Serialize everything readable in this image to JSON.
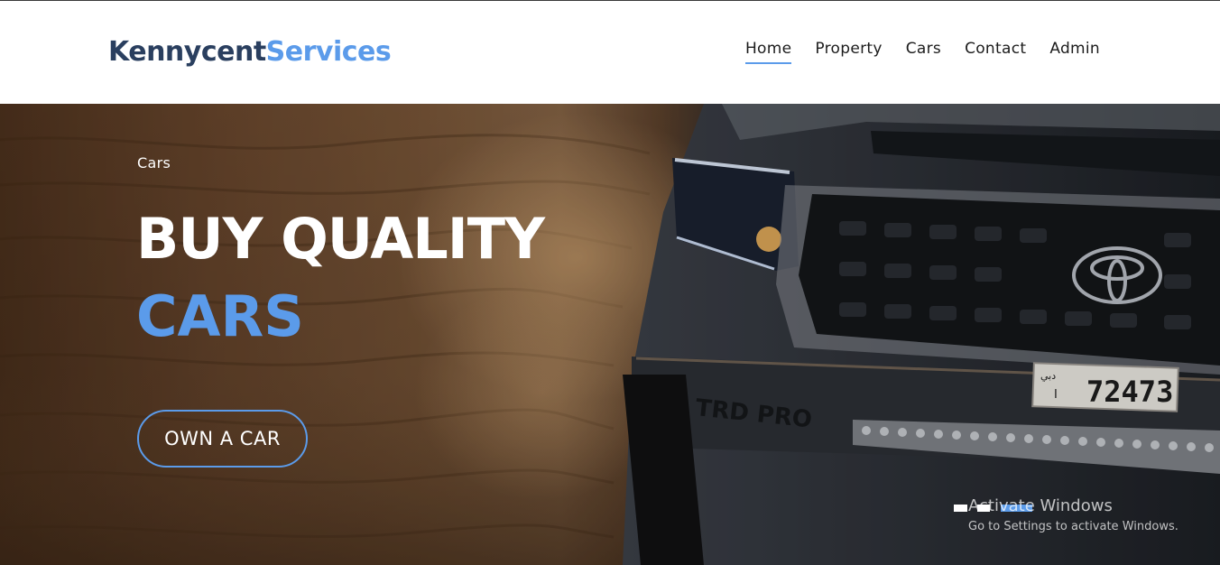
{
  "brand": {
    "name_part_1": "Kennycent",
    "name_part_2": "Services",
    "color_dark": "#2a3f5f",
    "color_accent": "#5b9bea"
  },
  "nav": {
    "items": [
      {
        "label": "Home",
        "active": true
      },
      {
        "label": "Property",
        "active": false
      },
      {
        "label": "Cars",
        "active": false
      },
      {
        "label": "Contact",
        "active": false
      },
      {
        "label": "Admin",
        "active": false
      }
    ]
  },
  "hero": {
    "eyebrow": "Cars",
    "title_line_1": "BUY QUALITY",
    "title_line_2": "CARS",
    "cta_label": "OWN A CAR",
    "plate_text": "72473",
    "plate_small": "دبي",
    "plate_letter": "I",
    "grille_text": "TRD PRO",
    "background_description_icon": "toyota-truck-in-desert-image"
  },
  "os_overlay": {
    "title": "Activate Windows",
    "subtitle": "Go to Settings to activate Windows."
  }
}
